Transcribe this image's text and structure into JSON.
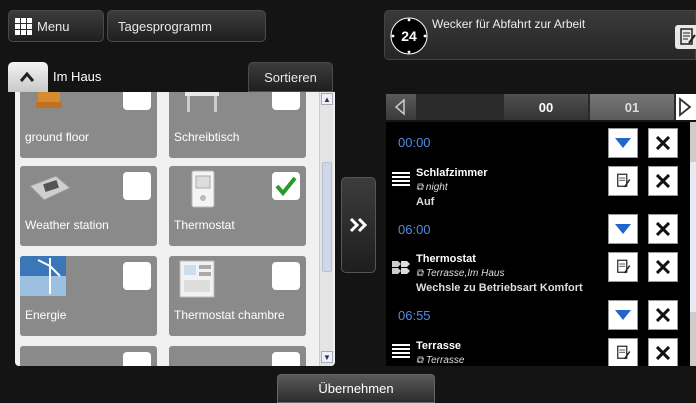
{
  "top": {
    "menu_label": "Menu",
    "day_program_label": "Tagesprogramm"
  },
  "left": {
    "room_title": "Im Haus",
    "sort_label": "Sortieren",
    "tiles": [
      {
        "label": "ground floor",
        "checked": false
      },
      {
        "label": "Schreibtisch",
        "checked": false
      },
      {
        "label": "Weather station",
        "checked": false
      },
      {
        "label": "Thermostat",
        "checked": true
      },
      {
        "label": "Energie",
        "checked": false
      },
      {
        "label": "Thermostat chambre",
        "checked": false
      }
    ]
  },
  "alarm": {
    "clock_label": "24",
    "title": "Wecker für Abfahrt zur Arbeit"
  },
  "schedule": {
    "tabs": [
      "00",
      "01"
    ],
    "slots": [
      {
        "time": "00:00",
        "title": "Schlafzimmer",
        "scope": "night",
        "action": "Auf"
      },
      {
        "time": "06:00",
        "title": "Thermostat",
        "scope": "Terrasse,Im Haus",
        "action": "Wechsle zu Betriebsart Komfort"
      },
      {
        "time": "06:55",
        "title": "Terrasse",
        "scope": "Terrasse",
        "action": ""
      }
    ]
  },
  "footer": {
    "apply_label": "Übernehmen"
  },
  "colors": {
    "accent_blue": "#4f8ce8",
    "check_green": "#2a9a2a",
    "dark_bg": "#141414"
  }
}
